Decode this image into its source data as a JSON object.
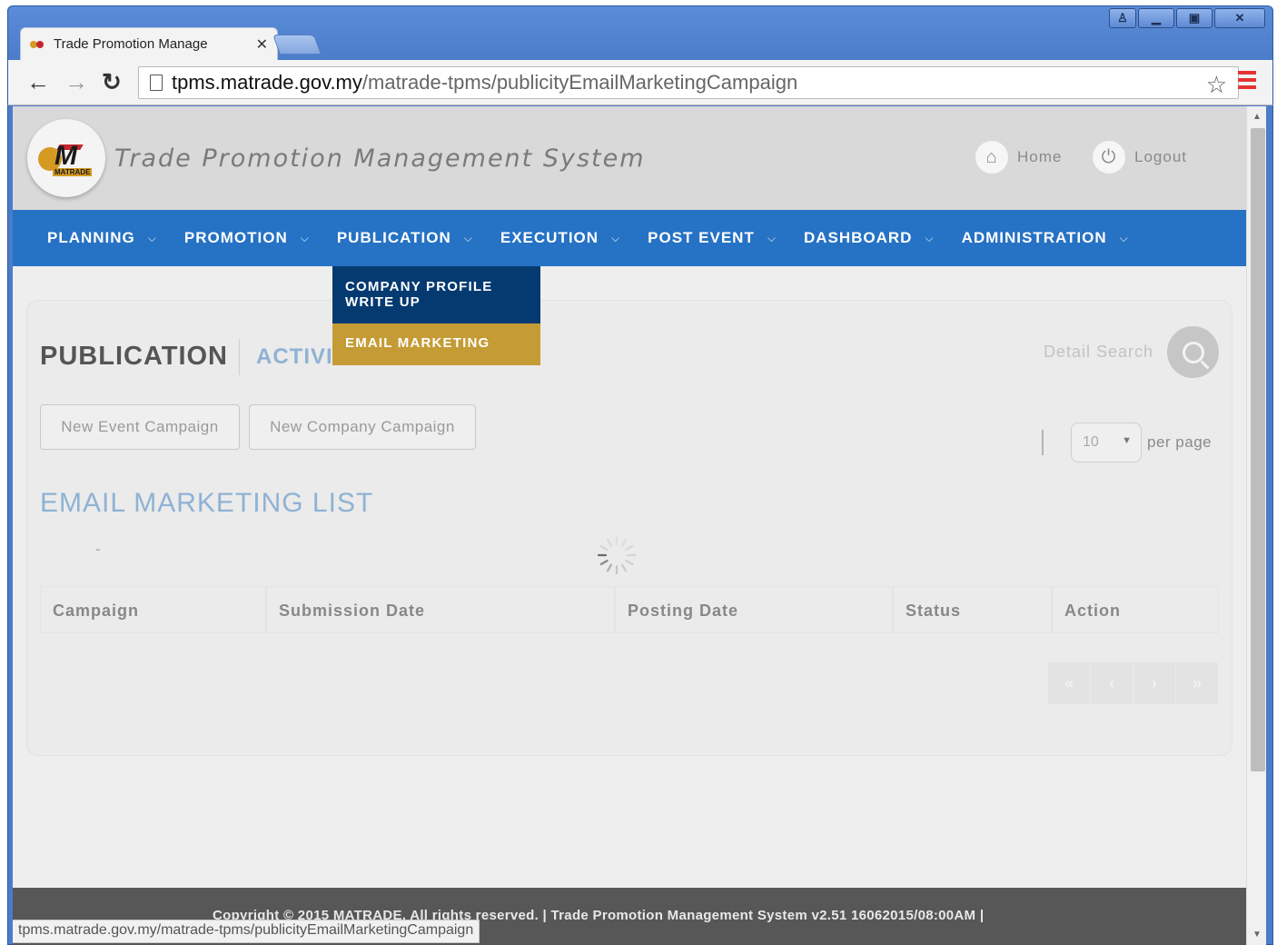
{
  "browser": {
    "tab_title": "Trade Promotion Manage",
    "tab_close": "✕",
    "url_host": "tpms.matrade.gov.my",
    "url_path": "/matrade-tpms/publicityEmailMarketingCampaign",
    "status_url": "tpms.matrade.gov.my/matrade-tpms/publicityEmailMarketingCampaign",
    "window_buttons": [
      "user",
      "minimize",
      "maximize",
      "close"
    ]
  },
  "header": {
    "logo_text": "MATRADE",
    "site_title": "Trade Promotion Management System",
    "home_label": "Home",
    "logout_label": "Logout"
  },
  "nav": {
    "items": [
      {
        "label": "PLANNING"
      },
      {
        "label": "PROMOTION"
      },
      {
        "label": "PUBLICATION"
      },
      {
        "label": "EXECUTION"
      },
      {
        "label": "POST EVENT"
      },
      {
        "label": "DASHBOARD"
      },
      {
        "label": "ADMINISTRATION"
      }
    ]
  },
  "dropdown": {
    "items": [
      {
        "label_line1": "COMPANY PROFILE",
        "label_line2": "WRITE UP"
      },
      {
        "label_line1": "EMAIL MARKETING"
      }
    ]
  },
  "page": {
    "title": "PUBLICATION",
    "subtitle": "ACTIVI",
    "detail_search": "Detail Search",
    "new_event_campaign": "New Event Campaign",
    "new_company_campaign": "New Company Campaign",
    "per_page_value": "10",
    "per_page_label": "per page",
    "list_title": "EMAIL MARKETING LIST",
    "table_headers": [
      "Campaign",
      "Submission Date",
      "Posting Date",
      "Status",
      "Action"
    ],
    "pager": [
      "«",
      "‹",
      "›",
      "»"
    ]
  },
  "footer": {
    "text": "Copyright © 2015 MATRADE. All rights reserved. | Trade Promotion Management System v2.51 16062015/08:00AM |"
  },
  "colors": {
    "nav_blue": "#2672c4",
    "dropdown_dark": "#053a71",
    "dropdown_gold": "#c59b35",
    "accent_light_blue": "#8fb2d4"
  }
}
